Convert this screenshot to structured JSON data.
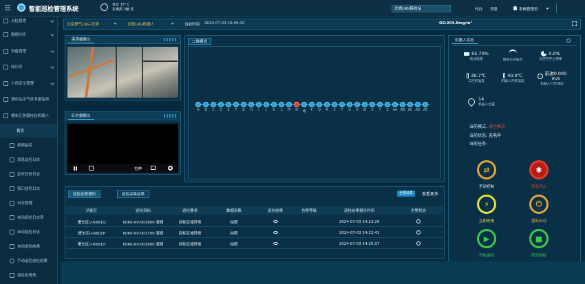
{
  "app": {
    "title": "智能巡检管理系统"
  },
  "weather": {
    "condition": "多云",
    "temp": "15° C",
    "wind": "东南风",
    "level": "3级",
    "quality": "优"
  },
  "topbar": {
    "search_value": "北燃LNG接收站",
    "items": [
      "代办",
      "消息"
    ],
    "user": "系统管理员"
  },
  "sidebar": {
    "items": [
      {
        "label": "点检管理"
      },
      {
        "label": "数据分析"
      },
      {
        "label": "设备管理"
      },
      {
        "label": "知识库"
      },
      {
        "label": "人员定位管理"
      },
      {
        "label": "液化站含气体泄露监测"
      },
      {
        "label": "槽车区防爆挂轨机器人"
      }
    ],
    "subitems": [
      {
        "label": "首页"
      },
      {
        "label": "视频监控"
      },
      {
        "label": "消息监控日志"
      },
      {
        "label": "定时任务日志"
      },
      {
        "label": "窗口监控日志"
      },
      {
        "label": "日志管理"
      },
      {
        "label": "自动巡检日志表"
      },
      {
        "label": "自动巡检日志"
      },
      {
        "label": "自动巡检结果"
      },
      {
        "label": "手动遥控巡检结果"
      },
      {
        "label": "巡检告警表"
      }
    ]
  },
  "filter": {
    "company": "北京燃气LNG-天津",
    "robot": "北燃LNG机器人",
    "time_label": "当前时间:",
    "time_value": "2024-07-03 16:40:32",
    "o2": "O2:204.8mg/m³"
  },
  "panels": {
    "hd_camera": "高清摄像仪",
    "ir_camera": "红外摄像仪",
    "map_2d": "二维模式",
    "robot_status": "机器人状态"
  },
  "video": {
    "zoom_label": "拉伸"
  },
  "timeline": {
    "labels": [
      "A",
      "B",
      "C",
      "D",
      "E",
      "F",
      "G",
      "H",
      "I",
      "J",
      "K",
      "L",
      "M",
      "N",
      "储",
      "P",
      "Q",
      "R",
      "S",
      "T",
      "U",
      "V",
      "W",
      "X",
      "Y",
      "Z",
      "AA",
      "AB",
      "AC",
      "AD",
      "AE"
    ],
    "active_index": 13
  },
  "robot": {
    "battery": {
      "value": "95.70%",
      "label": "电池电量"
    },
    "signal": {
      "label": "网络信号强度"
    },
    "cpu": {
      "value": "0.0%",
      "label": "工控内存占用率"
    },
    "ctrl_temp": {
      "value": "39.7℃",
      "label": "工控机温度"
    },
    "body_temp": {
      "value": "40.0℃",
      "label": "机器人内部温度"
    },
    "speed": {
      "value": "前进0.000",
      "unit": "m/s",
      "label": "机器人行走速度"
    },
    "position": {
      "value": "14",
      "label": "机器人位置"
    },
    "mode_label": "当前模式:",
    "mode_value": "遥控模式",
    "state_label": "当前状态:",
    "state_value": "充电中",
    "task_label": "当前任务:",
    "task_value": ""
  },
  "controls": [
    {
      "label": "手动控制",
      "color": "#e0a53b"
    },
    {
      "label": "紧急停止",
      "color": "#e53a2e"
    },
    {
      "label": "立即充电",
      "color": "#e3e13a"
    },
    {
      "label": "重新启动",
      "color": "#e0a53b"
    },
    {
      "label": "开始巡检",
      "color": "#3ec94a"
    },
    {
      "label": "取消巡检",
      "color": "#3ec94a"
    }
  ],
  "bottom": {
    "tabs": [
      "巡检告警通知",
      "巡检采集结果"
    ],
    "btn_all": "全部消息",
    "btn_more": "查看更多",
    "columns": [
      "功能区",
      "巡检目标",
      "巡检要求",
      "数据采集",
      "巡检结果",
      "告警等级",
      "巡检结果报告时间",
      "告警状态"
    ],
    "rows": [
      [
        "槽车区U-6601Q",
        "6060-XV-001800 液阀",
        "目标区域异常",
        "拍照",
        "",
        "",
        "2024-07-03 14:23:29",
        ""
      ],
      [
        "槽车区U-6601P",
        "6060-XV-001700 液阀",
        "目标区域异常",
        "拍照",
        "",
        "",
        "2024-07-03 14:22:41",
        ""
      ],
      [
        "槽车区U-6601O",
        "6060-XV-001600 液阀",
        "目标区域异常",
        "拍照",
        "",
        "",
        "2024-07-03 14:20:37",
        ""
      ]
    ]
  }
}
